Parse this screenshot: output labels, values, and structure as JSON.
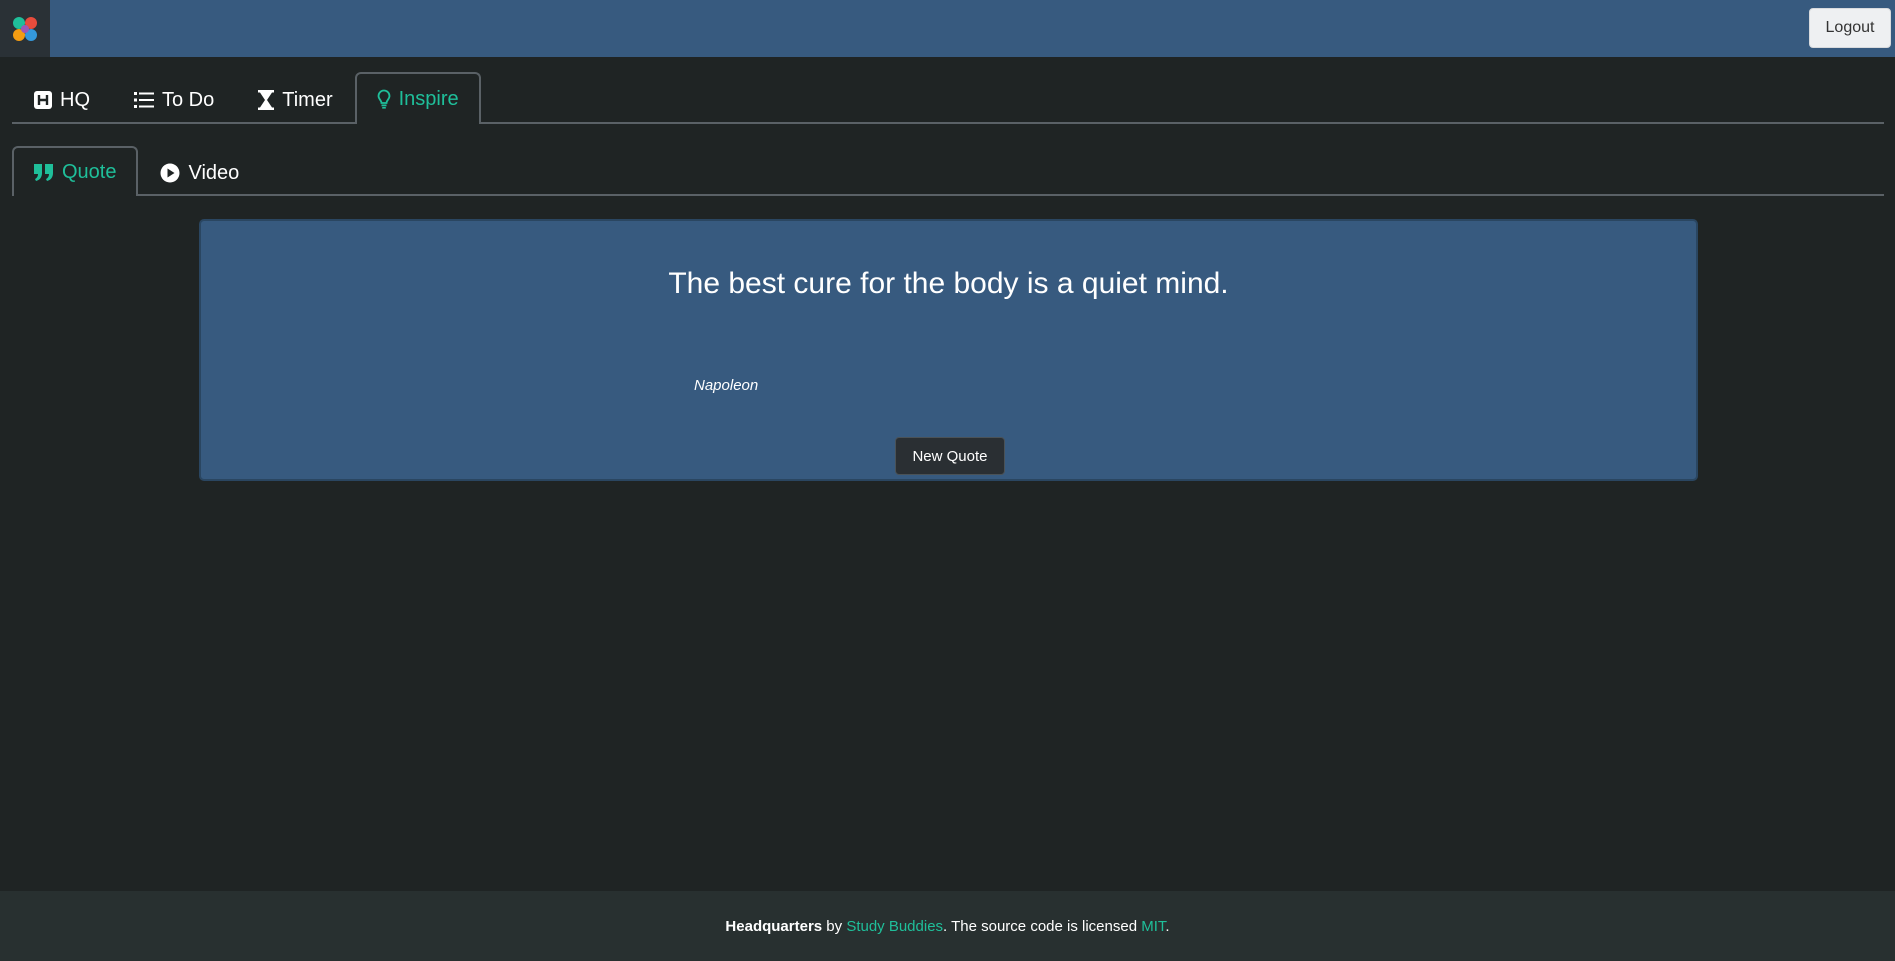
{
  "header": {
    "logout_label": "Logout",
    "accent": "#1fbf9a",
    "bar_color": "#375a7f"
  },
  "main_tabs": [
    {
      "label": "HQ",
      "icon": "h-square-icon",
      "active": false
    },
    {
      "label": "To Do",
      "icon": "list-icon",
      "active": false
    },
    {
      "label": "Timer",
      "icon": "hourglass-icon",
      "active": false
    },
    {
      "label": "Inspire",
      "icon": "lightbulb-icon",
      "active": true
    }
  ],
  "sub_tabs": [
    {
      "label": "Quote",
      "icon": "quote-icon",
      "active": true
    },
    {
      "label": "Video",
      "icon": "play-circle-icon",
      "active": false
    }
  ],
  "quote": {
    "text": "The best cure for the body is a quiet mind.",
    "author": "Napoleon",
    "button_label": "New Quote"
  },
  "footer": {
    "app_name": "Headquarters",
    "by_text": " by ",
    "org_link": "Study Buddies",
    "middle_text": ". The source code is licensed ",
    "license_link": "MIT",
    "end_text": "."
  }
}
